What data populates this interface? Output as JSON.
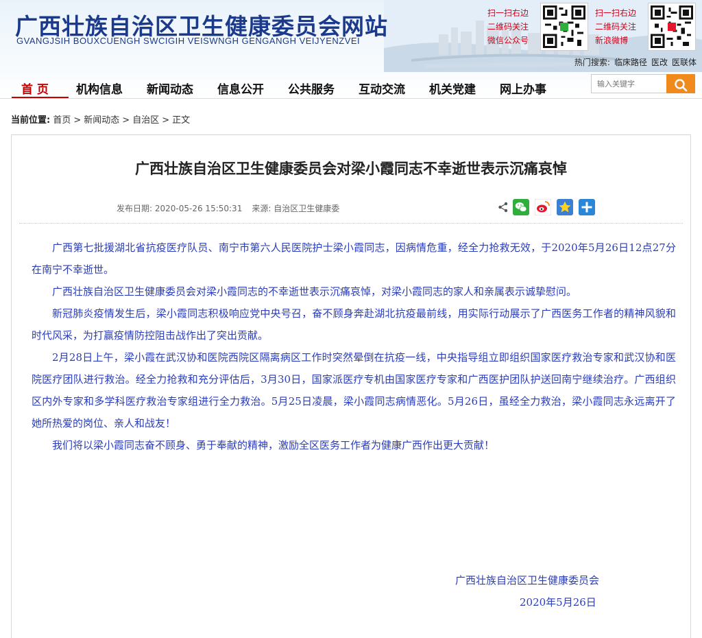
{
  "header": {
    "title": "广西壮族自治区卫生健康委员会网站",
    "subtitle": "GVANGJSIH BOUXCUENGH SWCIGIH VEISWNGH GENGANGH VEIJYENZVEI",
    "qr_wechat": [
      "扫一扫右边",
      "二维码关注",
      "微信公众号"
    ],
    "qr_weibo": [
      "扫一扫右边",
      "二维码关注",
      "新浪微博"
    ]
  },
  "hot_search": {
    "label": "热门搜索:",
    "items": [
      "临床路径",
      "医改",
      "医联体"
    ]
  },
  "nav": {
    "items": [
      "首 页",
      "机构信息",
      "新闻动态",
      "信息公开",
      "公共服务",
      "互动交流",
      "机关党建",
      "网上办事"
    ]
  },
  "search": {
    "placeholder": "输入关键字"
  },
  "breadcrumb": {
    "label": "当前位置:",
    "items": [
      "首页",
      "新闻动态",
      "自治区",
      "正文"
    ],
    "separator": ">"
  },
  "article": {
    "title": "广西壮族自治区卫生健康委员会对梁小霞同志不幸逝世表示沉痛哀悼",
    "date_label": "发布日期:",
    "date": "2020-05-26 15:50:31",
    "source_label": "来源:",
    "source": "自治区卫生健康委",
    "paragraphs": [
      "广西第七批援湖北省抗疫医疗队员、南宁市第六人民医院护士梁小霞同志，因病情危重，经全力抢救无效，于2020年5月26日12点27分在南宁不幸逝世。",
      "广西壮族自治区卫生健康委员会对梁小霞同志的不幸逝世表示沉痛哀悼，对梁小霞同志的家人和亲属表示诚挚慰问。",
      "新冠肺炎疫情发生后，梁小霞同志积极响应党中央号召，奋不顾身奔赴湖北抗疫最前线，用实际行动展示了广西医务工作者的精神风貌和时代风采，为打赢疫情防控阻击战作出了突出贡献。",
      "2月28日上午，梁小霞在武汉协和医院西院区隔离病区工作时突然晕倒在抗疫一线，中央指导组立即组织国家医疗救治专家和武汉协和医院医疗团队进行救治。经全力抢救和充分评估后，3月30日，国家派医疗专机由国家医疗专家和广西医护团队护送回南宁继续治疗。广西组织区内外专家和多学科医疗救治专家组进行全力救治。5月25日凌晨，梁小霞同志病情恶化。5月26日，虽经全力救治，梁小霞同志永远离开了她所热爱的岗位、亲人和战友！",
      "我们将以梁小霞同志奋不顾身、勇于奉献的精神，激励全区医务工作者为健康广西作出更大贡献！"
    ],
    "signature_org": "广西壮族自治区卫生健康委员会",
    "signature_date": "2020年5月26日"
  },
  "colors": {
    "brand_blue": "#1c3a8c",
    "nav_active": "#c40000",
    "body_text": "#2b3db8",
    "search_button": "#f08a1c"
  }
}
